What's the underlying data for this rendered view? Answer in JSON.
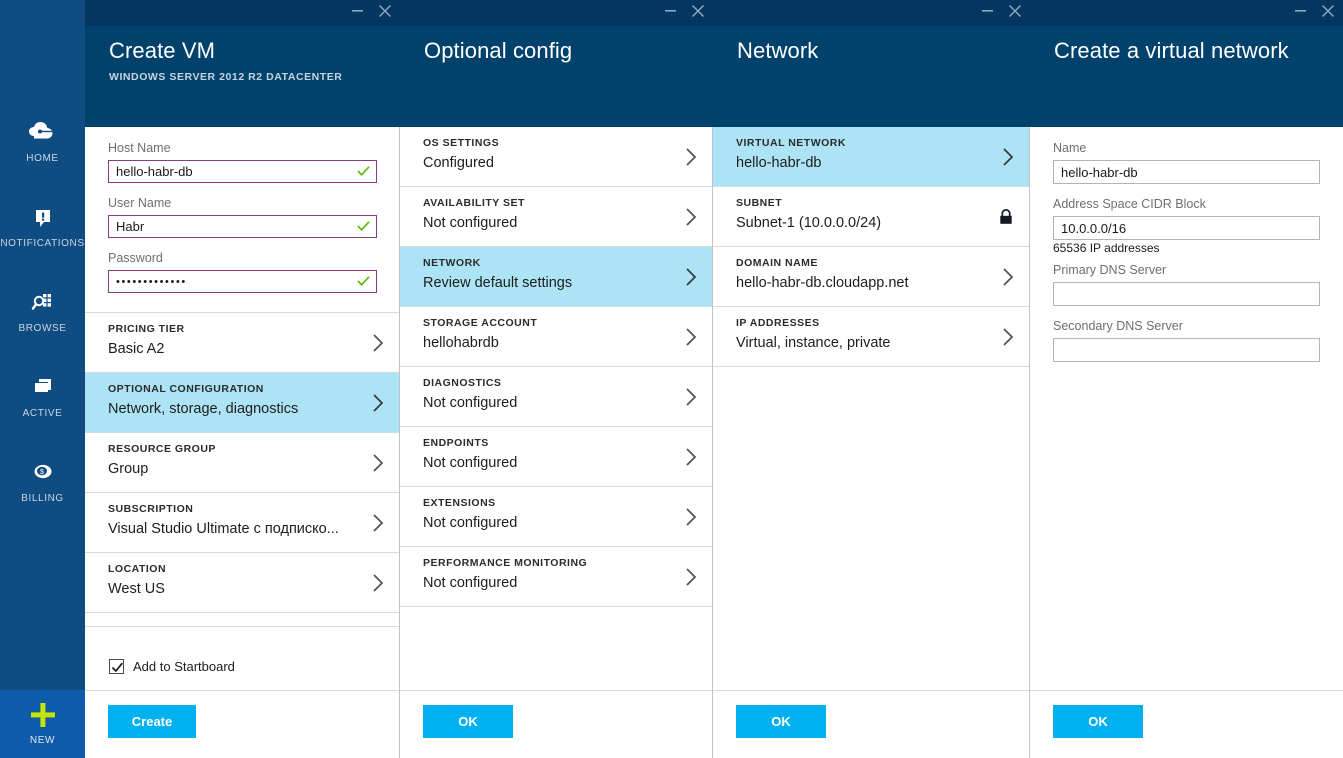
{
  "rail": {
    "items": [
      {
        "label": "HOME",
        "icon": "cloud-home-icon"
      },
      {
        "label": "NOTIFICATIONS",
        "icon": "notification-bell-icon"
      },
      {
        "label": "BROWSE",
        "icon": "browse-search-icon"
      },
      {
        "label": "ACTIVE",
        "icon": "active-window-icon"
      },
      {
        "label": "BILLING",
        "icon": "billing-coin-icon"
      }
    ],
    "new_label": "NEW",
    "new_icon": "plus-icon"
  },
  "blades": {
    "create_vm": {
      "title": "Create VM",
      "subtitle": "WINDOWS SERVER 2012 R2 DATACENTER",
      "fields": [
        {
          "label": "Host Name",
          "value": "hello-habr-db",
          "valid": true
        },
        {
          "label": "User Name",
          "value": "Habr",
          "valid": true
        },
        {
          "label": "Password",
          "value": "•••••••••••••",
          "valid": true
        }
      ],
      "rows": [
        {
          "caption": "PRICING TIER",
          "value": "Basic A2",
          "selected": false
        },
        {
          "caption": "OPTIONAL CONFIGURATION",
          "value": "Network, storage, diagnostics",
          "selected": true
        },
        {
          "caption": "RESOURCE GROUP",
          "value": "Group",
          "selected": false
        },
        {
          "caption": "SUBSCRIPTION",
          "value": "Visual Studio Ultimate с подписко...",
          "selected": false
        },
        {
          "caption": "LOCATION",
          "value": "West US",
          "selected": false
        }
      ],
      "startboard_label": "Add to Startboard",
      "startboard_checked": true,
      "submit_label": "Create"
    },
    "optional_config": {
      "title": "Optional config",
      "rows": [
        {
          "caption": "OS SETTINGS",
          "value": "Configured",
          "selected": false
        },
        {
          "caption": "AVAILABILITY SET",
          "value": "Not configured",
          "selected": false
        },
        {
          "caption": "NETWORK",
          "value": "Review default settings",
          "selected": true
        },
        {
          "caption": "STORAGE ACCOUNT",
          "value": "hellohabrdb",
          "selected": false
        },
        {
          "caption": "DIAGNOSTICS",
          "value": "Not configured",
          "selected": false
        },
        {
          "caption": "ENDPOINTS",
          "value": "Not configured",
          "selected": false
        },
        {
          "caption": "EXTENSIONS",
          "value": "Not configured",
          "selected": false
        },
        {
          "caption": "PERFORMANCE MONITORING",
          "value": "Not configured",
          "selected": false
        }
      ],
      "submit_label": "OK"
    },
    "network": {
      "title": "Network",
      "rows": [
        {
          "caption": "VIRTUAL NETWORK",
          "value": "hello-habr-db",
          "selected": true,
          "accessory": "chevron"
        },
        {
          "caption": "SUBNET",
          "value": "Subnet-1 (10.0.0.0/24)",
          "selected": false,
          "accessory": "lock"
        },
        {
          "caption": "DOMAIN NAME",
          "value": "hello-habr-db.cloudapp.net",
          "selected": false,
          "accessory": "chevron"
        },
        {
          "caption": "IP ADDRESSES",
          "value": "Virtual, instance, private",
          "selected": false,
          "accessory": "chevron"
        }
      ],
      "submit_label": "OK"
    },
    "create_vnet": {
      "title": "Create a virtual network",
      "fields": [
        {
          "label": "Name",
          "value": "hello-habr-db",
          "hint": ""
        },
        {
          "label": "Address Space CIDR Block",
          "value": "10.0.0.0/16",
          "hint": "65536 IP addresses"
        },
        {
          "label": "Primary DNS Server",
          "value": "",
          "hint": ""
        },
        {
          "label": "Secondary DNS Server",
          "value": "",
          "hint": ""
        }
      ],
      "submit_label": "OK"
    }
  },
  "window_controls": {
    "minimize": "—",
    "close": "✕"
  },
  "colors": {
    "rail_bg": "#0f4c81",
    "blade_header": "#01426c",
    "title_bar": "#033660",
    "selection": "#ade4f5",
    "accent_button": "#00b0f0",
    "validated_field_border": "#8c3a86",
    "check_green": "#5fb800",
    "new_plus": "#c6e500"
  }
}
